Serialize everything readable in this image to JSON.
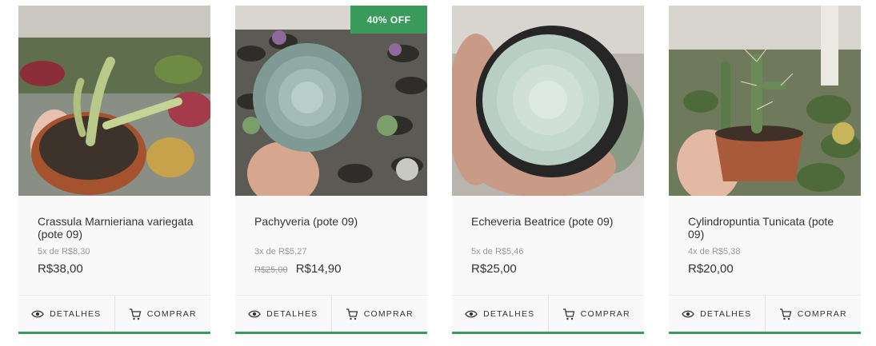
{
  "brand": {
    "accent": "#3a9a5c"
  },
  "actions": {
    "details_label": "DETALHES",
    "details_icon": "eye-icon",
    "buy_label": "COMPRAR",
    "buy_icon": "cart-icon"
  },
  "products": [
    {
      "name": "Crassula Marnieriana variegata (pote 09)",
      "installments": "5x de R$8,30",
      "old_price": "",
      "price": "R$38,00",
      "badge": ""
    },
    {
      "name": "Pachyveria (pote 09)",
      "installments": "3x de R$5,27",
      "old_price": "R$25,00",
      "price": "R$14,90",
      "badge": "40% OFF"
    },
    {
      "name": "Echeveria Beatrice (pote 09)",
      "installments": "5x de R$5,46",
      "old_price": "",
      "price": "R$25,00",
      "badge": ""
    },
    {
      "name": "Cylindropuntia Tunicata (pote 09)",
      "installments": "4x de R$5,38",
      "old_price": "",
      "price": "R$20,00",
      "badge": ""
    }
  ]
}
